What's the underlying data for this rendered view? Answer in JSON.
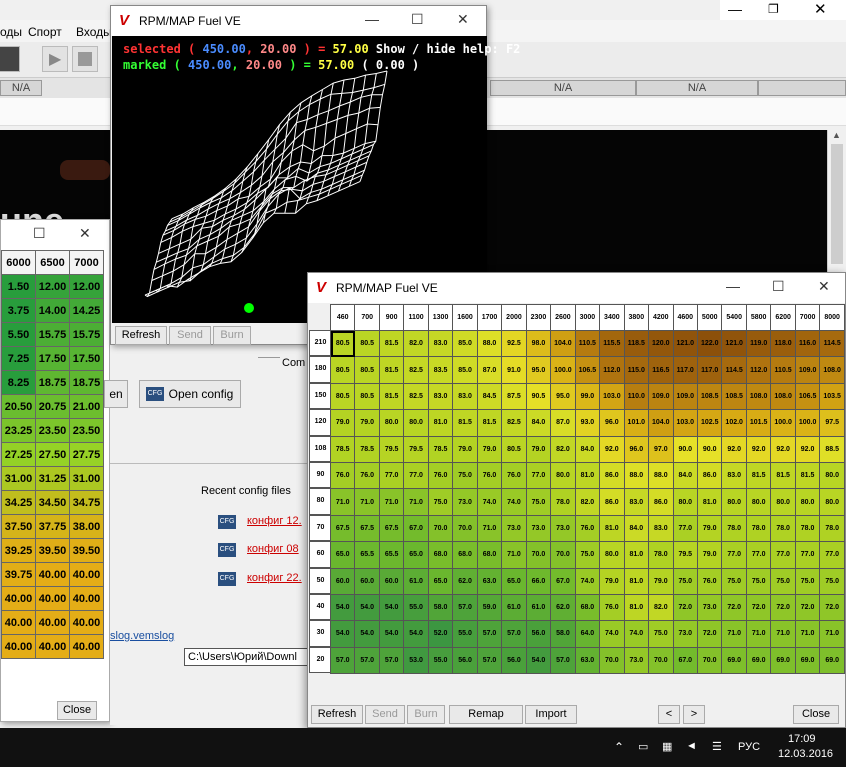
{
  "bg": {
    "menu": [
      "оды",
      "Спорт",
      "Входы"
    ],
    "na": [
      "N/A",
      "N/A",
      "N/A"
    ]
  },
  "left": {
    "header": [
      "6000",
      "6500",
      "7000"
    ],
    "rows": [
      [
        "1.50",
        "12.00",
        "12.00"
      ],
      [
        "3.75",
        "14.00",
        "14.25"
      ],
      [
        "5.50",
        "15.75",
        "15.75"
      ],
      [
        "7.25",
        "17.50",
        "17.50"
      ],
      [
        "8.25",
        "18.75",
        "18.75"
      ],
      [
        "20.50",
        "20.75",
        "21.00"
      ],
      [
        "23.25",
        "23.50",
        "23.50"
      ],
      [
        "27.25",
        "27.50",
        "27.75"
      ],
      [
        "31.00",
        "31.25",
        "31.00"
      ],
      [
        "34.25",
        "34.50",
        "34.75"
      ],
      [
        "37.50",
        "37.75",
        "38.00"
      ],
      [
        "39.25",
        "39.50",
        "39.50"
      ],
      [
        "39.75",
        "40.00",
        "40.00"
      ],
      [
        "40.00",
        "40.00",
        "40.00"
      ],
      [
        "40.00",
        "40.00",
        "40.00"
      ],
      [
        "40.00",
        "40.00",
        "40.00"
      ]
    ],
    "close": "Close"
  },
  "mid": {
    "title": "RPM/MAP Fuel VE",
    "l1a": "selected ( ",
    "l1b": "450.00",
    "l1c": ", ",
    "l1d": "20.00",
    "l1e": " ) = ",
    "l1f": "57.00",
    "l1g": " Show / hide help: F2",
    "l2a": "marked ( ",
    "l2b": "450.00",
    "l2c": ", ",
    "l2d": "20.00",
    "l2e": " ) = ",
    "l2f": "57.00",
    "l2g": " ( 0.00 )",
    "refresh": "Refresh",
    "send": "Send",
    "burn": "Burn"
  },
  "cfg": {
    "group": "Com",
    "btn1": "en",
    "open": "Open config",
    "recent": "Recent config files",
    "files": [
      "конфиг 12.",
      "конфиг 08",
      "конфиг 22."
    ],
    "vems": "slog.vemslog",
    "tip": "C:\\Users\\Юрий\\Downl"
  },
  "ve": {
    "title": "RPM/MAP Fuel VE",
    "rpm": [
      "460",
      "700",
      "900",
      "1100",
      "1300",
      "1600",
      "1700",
      "2000",
      "2300",
      "2600",
      "3000",
      "3400",
      "3800",
      "4200",
      "4600",
      "5000",
      "5400",
      "5800",
      "6200",
      "7000",
      "8000"
    ],
    "map": [
      "210",
      "180",
      "150",
      "120",
      "108",
      "90",
      "80",
      "70",
      "60",
      "50",
      "40",
      "30",
      "20"
    ],
    "cells": [
      [
        "80.5",
        "80.5",
        "81.5",
        "82.0",
        "83.0",
        "85.0",
        "88.0",
        "92.5",
        "98.0",
        "104.0",
        "110.5",
        "115.5",
        "118.5",
        "120.0",
        "121.0",
        "122.0",
        "121.0",
        "119.0",
        "118.0",
        "116.0",
        "114.5"
      ],
      [
        "80.5",
        "80.5",
        "81.5",
        "82.5",
        "83.5",
        "85.0",
        "87.0",
        "91.0",
        "95.0",
        "100.0",
        "106.5",
        "112.0",
        "115.0",
        "116.5",
        "117.0",
        "117.0",
        "114.5",
        "112.0",
        "110.5",
        "109.0",
        "108.0"
      ],
      [
        "80.5",
        "80.5",
        "81.5",
        "82.5",
        "83.0",
        "83.0",
        "84.5",
        "87.5",
        "90.5",
        "95.0",
        "99.0",
        "103.0",
        "110.0",
        "109.0",
        "109.0",
        "108.5",
        "108.5",
        "108.0",
        "108.0",
        "106.5",
        "103.5"
      ],
      [
        "79.0",
        "79.0",
        "80.0",
        "80.0",
        "81.0",
        "81.5",
        "81.5",
        "82.5",
        "84.0",
        "87.0",
        "93.0",
        "96.0",
        "101.0",
        "104.0",
        "103.0",
        "102.5",
        "102.0",
        "101.5",
        "100.0",
        "100.0",
        "97.5"
      ],
      [
        "78.5",
        "78.5",
        "79.5",
        "79.5",
        "78.5",
        "79.0",
        "79.0",
        "80.5",
        "79.0",
        "82.0",
        "84.0",
        "92.0",
        "96.0",
        "97.0",
        "90.0",
        "90.0",
        "92.0",
        "92.0",
        "92.0",
        "92.0",
        "88.5"
      ],
      [
        "76.0",
        "76.0",
        "77.0",
        "77.0",
        "76.0",
        "75.0",
        "76.0",
        "76.0",
        "77.0",
        "80.0",
        "81.0",
        "86.0",
        "88.0",
        "88.0",
        "84.0",
        "86.0",
        "83.0",
        "81.5",
        "81.5",
        "81.5",
        "80.0"
      ],
      [
        "71.0",
        "71.0",
        "71.0",
        "71.0",
        "75.0",
        "73.0",
        "74.0",
        "74.0",
        "75.0",
        "78.0",
        "82.0",
        "86.0",
        "83.0",
        "86.0",
        "80.0",
        "81.0",
        "80.0",
        "80.0",
        "80.0",
        "80.0",
        "80.0"
      ],
      [
        "67.5",
        "67.5",
        "67.5",
        "67.0",
        "70.0",
        "70.0",
        "71.0",
        "73.0",
        "73.0",
        "73.0",
        "76.0",
        "81.0",
        "84.0",
        "83.0",
        "77.0",
        "79.0",
        "78.0",
        "78.0",
        "78.0",
        "78.0",
        "78.0"
      ],
      [
        "65.0",
        "65.5",
        "65.5",
        "65.0",
        "68.0",
        "68.0",
        "68.0",
        "71.0",
        "70.0",
        "70.0",
        "75.0",
        "80.0",
        "81.0",
        "78.0",
        "79.5",
        "79.0",
        "77.0",
        "77.0",
        "77.0",
        "77.0",
        "77.0"
      ],
      [
        "60.0",
        "60.0",
        "60.0",
        "61.0",
        "65.0",
        "62.0",
        "63.0",
        "65.0",
        "66.0",
        "67.0",
        "74.0",
        "79.0",
        "81.0",
        "79.0",
        "75.0",
        "76.0",
        "75.0",
        "75.0",
        "75.0",
        "75.0",
        "75.0"
      ],
      [
        "54.0",
        "54.0",
        "54.0",
        "55.0",
        "58.0",
        "57.0",
        "59.0",
        "61.0",
        "61.0",
        "62.0",
        "68.0",
        "76.0",
        "81.0",
        "82.0",
        "72.0",
        "73.0",
        "72.0",
        "72.0",
        "72.0",
        "72.0",
        "72.0"
      ],
      [
        "54.0",
        "54.0",
        "54.0",
        "54.0",
        "52.0",
        "55.0",
        "57.0",
        "57.0",
        "56.0",
        "58.0",
        "64.0",
        "74.0",
        "74.0",
        "75.0",
        "73.0",
        "72.0",
        "71.0",
        "71.0",
        "71.0",
        "71.0",
        "71.0"
      ],
      [
        "57.0",
        "57.0",
        "57.0",
        "53.0",
        "55.0",
        "56.0",
        "57.0",
        "56.0",
        "54.0",
        "57.0",
        "63.0",
        "70.0",
        "73.0",
        "70.0",
        "67.0",
        "70.0",
        "69.0",
        "69.0",
        "69.0",
        "69.0",
        "69.0"
      ]
    ],
    "refresh": "Refresh",
    "send": "Send",
    "burn": "Burn",
    "remap": "Remap",
    "import": "Import",
    "prev": "<",
    "next": ">",
    "close": "Close"
  },
  "task": {
    "lang": "РУС",
    "time": "17:09",
    "date": "12.03.2016"
  }
}
